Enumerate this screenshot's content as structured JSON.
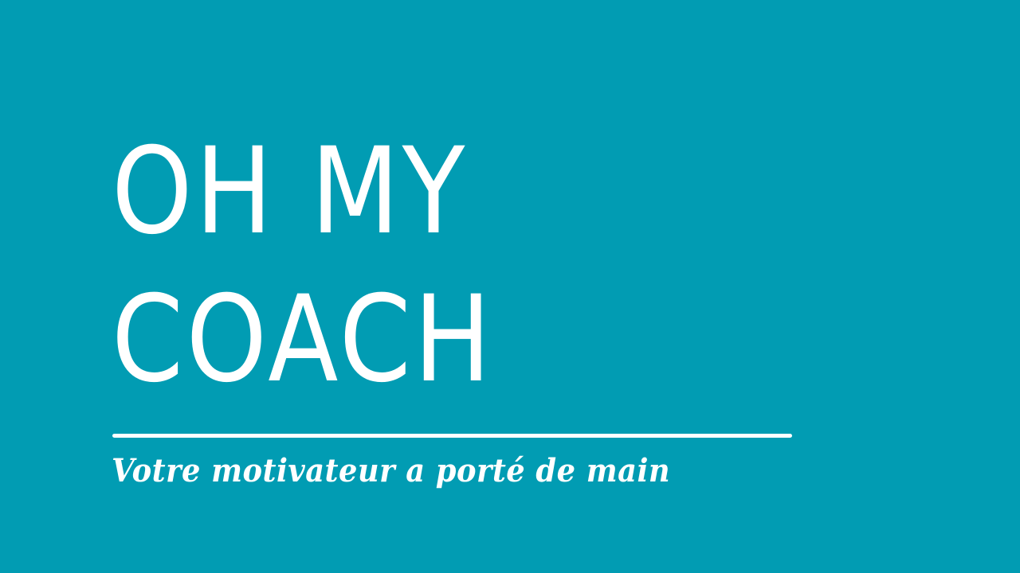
{
  "background_color": "#019cb3",
  "text_color": "#ffffff",
  "title": {
    "line1": "OH MY",
    "line2": "COACH"
  },
  "tagline": "Votre motivateur a porté de main"
}
